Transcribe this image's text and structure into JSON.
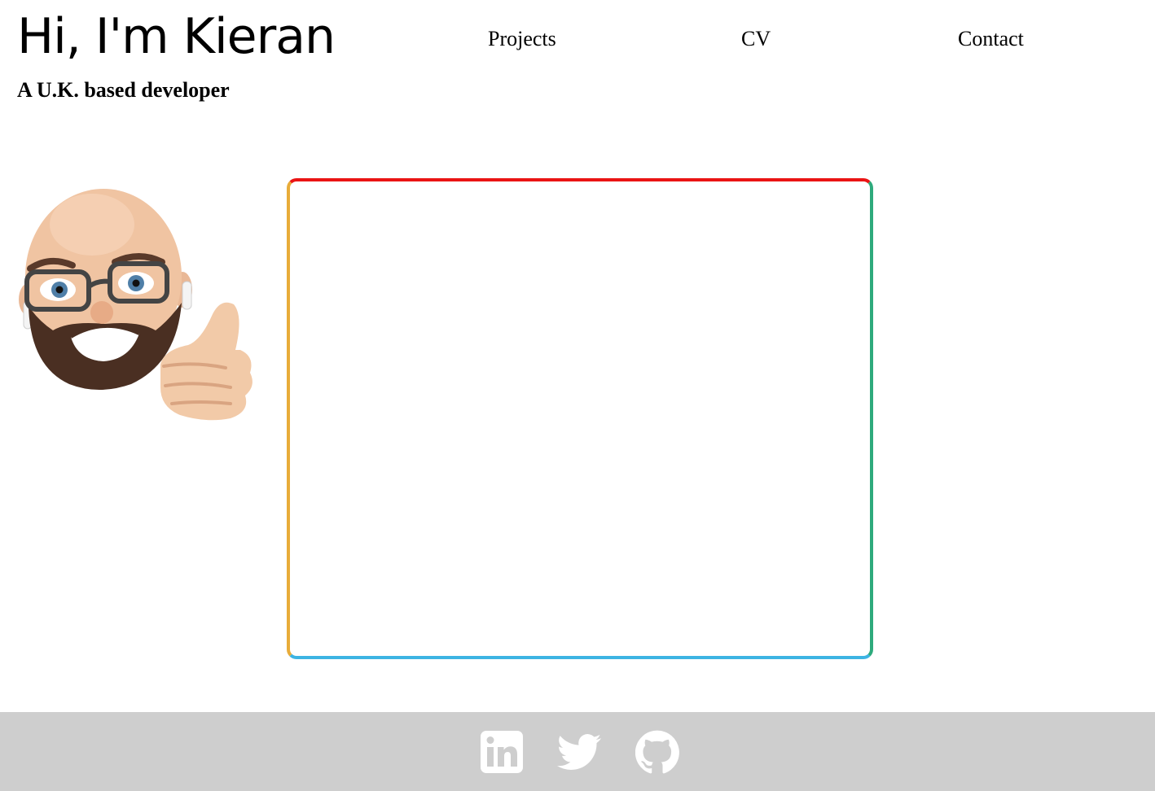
{
  "header": {
    "title": "Hi, I'm Kieran",
    "tagline": "A U.K. based developer"
  },
  "nav": {
    "items": [
      {
        "label": "Projects"
      },
      {
        "label": "CV"
      },
      {
        "label": "Contact"
      }
    ]
  },
  "hero": {
    "avatar_icon": "memoji-thumbs-up-avatar",
    "frame_colors": {
      "top": "#ea1414",
      "right": "#2eaa7c",
      "bottom": "#3db4e3",
      "left": "#e8ac3a"
    }
  },
  "footer": {
    "background": "#cecece",
    "icon_color": "#ffffff",
    "social": [
      {
        "icon": "linkedin-icon"
      },
      {
        "icon": "twitter-icon"
      },
      {
        "icon": "github-icon"
      }
    ]
  }
}
